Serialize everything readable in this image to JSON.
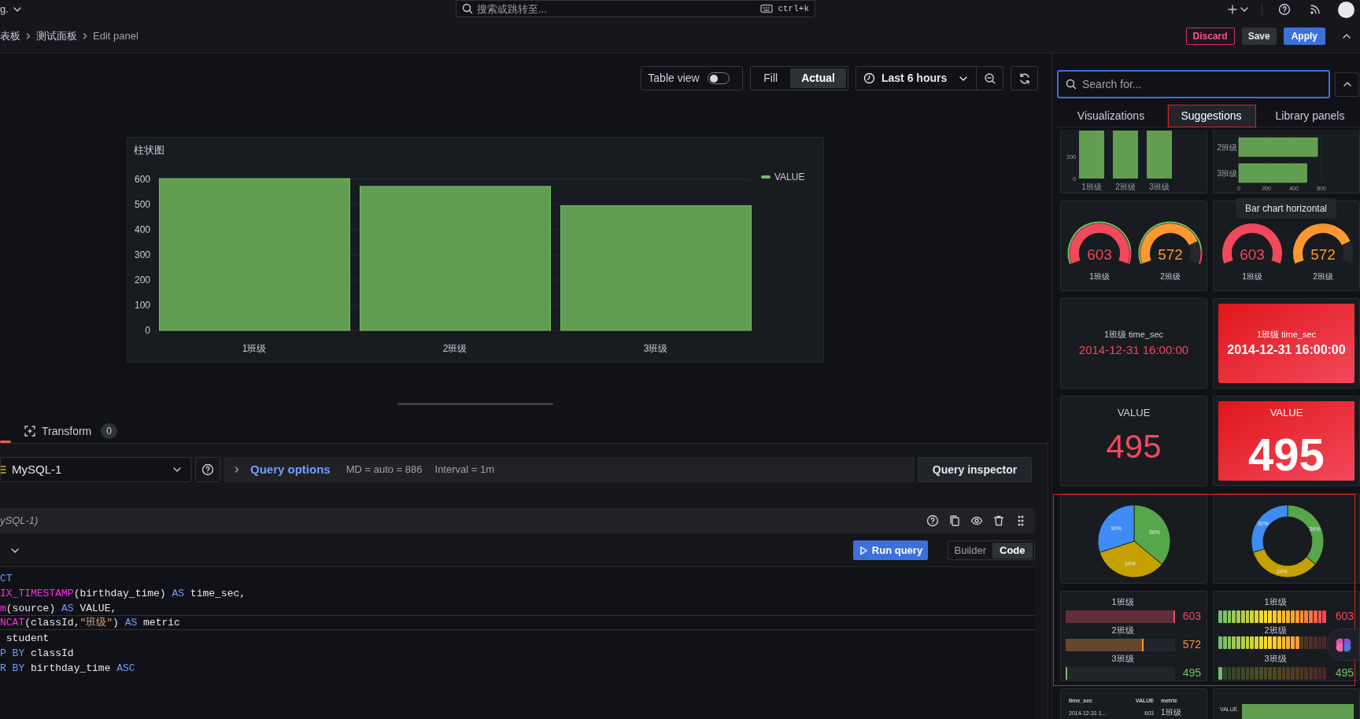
{
  "top_bar": {
    "org_menu": "g.",
    "search": {
      "placeholder": "搜索或跳转至...",
      "shortcut": "ctrl+k"
    }
  },
  "breadcrumbs": [
    "表板",
    "测试面板",
    "Edit panel"
  ],
  "header_buttons": [
    {
      "label": "Discard",
      "kind": "destructive"
    },
    {
      "label": "Save",
      "kind": "secondary"
    },
    {
      "label": "Apply",
      "kind": "primary"
    }
  ],
  "toolbar": {
    "table_view": {
      "label": "Table view",
      "on": false
    },
    "display_modes": [
      {
        "label": "Fill",
        "selected": false
      },
      {
        "label": "Actual",
        "selected": true
      }
    ],
    "time_range": "Last 6 hours"
  },
  "panel": {
    "chart_data": {
      "type": "bar",
      "title": "柱状图",
      "categories": [
        "1班级",
        "2班级",
        "3班级"
      ],
      "series": [
        {
          "name": "VALUE",
          "color": "#73bf69",
          "values": [
            603,
            572,
            495
          ]
        }
      ],
      "ylim": [
        0,
        610
      ],
      "yticks": [
        0,
        100,
        200,
        300,
        400,
        500,
        600
      ],
      "grid": true
    }
  },
  "query_tabs": [
    {
      "label": "Transform",
      "count": "0"
    }
  ],
  "query": {
    "datasource": "MySQL-1",
    "options_label": "Query options",
    "options_info": [
      "MD = auto = 886",
      "Interval = 1m"
    ],
    "inspector": "Query inspector",
    "row_title": "ySQL-1)",
    "run": "Run query",
    "modes": [
      {
        "label": "Builder",
        "selected": false
      },
      {
        "label": "Code",
        "selected": true
      }
    ],
    "code_lines": [
      {
        "current": false,
        "tokens": [
          {
            "kind": "keyword",
            "text": "CT"
          }
        ]
      },
      {
        "current": false,
        "tokens": [
          {
            "kind": "function",
            "text": "IX_TIMESTAMP"
          },
          {
            "kind": "plain",
            "text": "(birthday_time) "
          },
          {
            "kind": "keyword",
            "text": "AS"
          },
          {
            "kind": "plain",
            "text": " time_sec,"
          }
        ]
      },
      {
        "current": false,
        "tokens": [
          {
            "kind": "function",
            "text": "m"
          },
          {
            "kind": "plain",
            "text": "(source) "
          },
          {
            "kind": "keyword",
            "text": "AS"
          },
          {
            "kind": "plain",
            "text": " VALUE,"
          }
        ]
      },
      {
        "current": true,
        "tokens": [
          {
            "kind": "function",
            "text": "NCAT"
          },
          {
            "kind": "plain",
            "text": "(classId,"
          },
          {
            "kind": "string",
            "text": "\"班级\""
          },
          {
            "kind": "plain",
            "text": ") "
          },
          {
            "kind": "keyword",
            "text": "AS"
          },
          {
            "kind": "plain",
            "text": " metric"
          }
        ]
      },
      {
        "current": false,
        "tokens": [
          {
            "kind": "plain",
            "text": " student"
          }
        ]
      },
      {
        "current": false,
        "tokens": [
          {
            "kind": "keyword",
            "text": "P BY"
          },
          {
            "kind": "plain",
            "text": " classId"
          }
        ]
      },
      {
        "current": false,
        "tokens": [
          {
            "kind": "keyword",
            "text": "R BY"
          },
          {
            "kind": "plain",
            "text": " birthday_time "
          },
          {
            "kind": "keyword",
            "text": "ASC"
          }
        ]
      }
    ]
  },
  "sidebar": {
    "search": {
      "placeholder": "Search for..."
    },
    "tabs": [
      {
        "label": "Visualizations",
        "selected": false
      },
      {
        "label": "Suggestions",
        "selected": true
      },
      {
        "label": "Library panels",
        "selected": false
      }
    ],
    "tooltip": "Bar chart horizontal",
    "cards": [
      {
        "kind": "bar_thumb",
        "yticks": [
          "200",
          "0"
        ],
        "categories": [
          "1班级",
          "2班级",
          "3班级"
        ]
      },
      {
        "kind": "bar_chart",
        "chart_data": {
          "type": "bar",
          "orientation": "horizontal",
          "categories": [
            "2班级",
            "3班级"
          ],
          "series": [
            {
              "color": "#73bf69",
              "values": [
                572,
                495
              ]
            }
          ],
          "xlim": [
            0,
            600
          ],
          "xticks": [
            0,
            200,
            400,
            600
          ],
          "grid": true
        }
      },
      {
        "kind": "gauge",
        "threshold_markers": true,
        "gauges": [
          {
            "value": "603",
            "label": "1班级",
            "color": "#f2495c"
          },
          {
            "value": "572",
            "label": "2班级",
            "color": "#ff9830"
          }
        ]
      },
      {
        "kind": "gauge",
        "threshold_markers": false,
        "gauges": [
          {
            "value": "603",
            "label": "1班级",
            "color": "#f2495c"
          },
          {
            "value": "572",
            "label": "2班级",
            "color": "#ff9830"
          }
        ]
      },
      {
        "kind": "stat_time",
        "background": false,
        "color": "#f2495c",
        "label": "1班级 time_sec",
        "value": "2014-12-31 16:00:00"
      },
      {
        "kind": "stat_time",
        "background": true,
        "color": "#f2495c",
        "label": "1班级 time_sec",
        "value": "2014-12-31 16:00:00"
      },
      {
        "kind": "stat_value",
        "background": false,
        "color": "#f2495c",
        "label": "VALUE",
        "value": "495"
      },
      {
        "kind": "stat_value",
        "background": true,
        "color": "#f2495c",
        "label": "VALUE",
        "value": "495"
      },
      {
        "kind": "pie",
        "chart_data": {
          "type": "pie",
          "values": [
            36,
            34,
            30
          ],
          "value_labels": [
            "36%",
            "34%",
            "30%"
          ]
        }
      },
      {
        "kind": "pie",
        "chart_data": {
          "type": "donut",
          "values": [
            36,
            34,
            30
          ],
          "value_labels": [
            "36%",
            "34%",
            "30%"
          ]
        }
      },
      {
        "kind": "bar_gauge_basic",
        "rows": [
          {
            "label": "1班级",
            "value": "603",
            "level": 1,
            "color": "#f2495c"
          },
          {
            "label": "2班级",
            "value": "572",
            "level": 0.71,
            "color": "#ff9830"
          },
          {
            "label": "3班级",
            "value": "495",
            "level": 0,
            "color": "#73bf69"
          }
        ]
      },
      {
        "kind": "bar_gauge_lcd",
        "rows": [
          {
            "label": "1班级",
            "value": "603",
            "color": "#f2495c"
          },
          {
            "label": "2班级"
          },
          {
            "label": "3班级",
            "value": "495",
            "color": "#73bf69"
          }
        ]
      },
      {
        "kind": "table",
        "columns": [
          "time_sec",
          "VALUE",
          "metric"
        ],
        "rows": [
          [
            "2014-12-31 1...",
            "603",
            "1班级"
          ]
        ]
      },
      {
        "kind": "bar_snippet",
        "label": "VALUE"
      }
    ]
  }
}
